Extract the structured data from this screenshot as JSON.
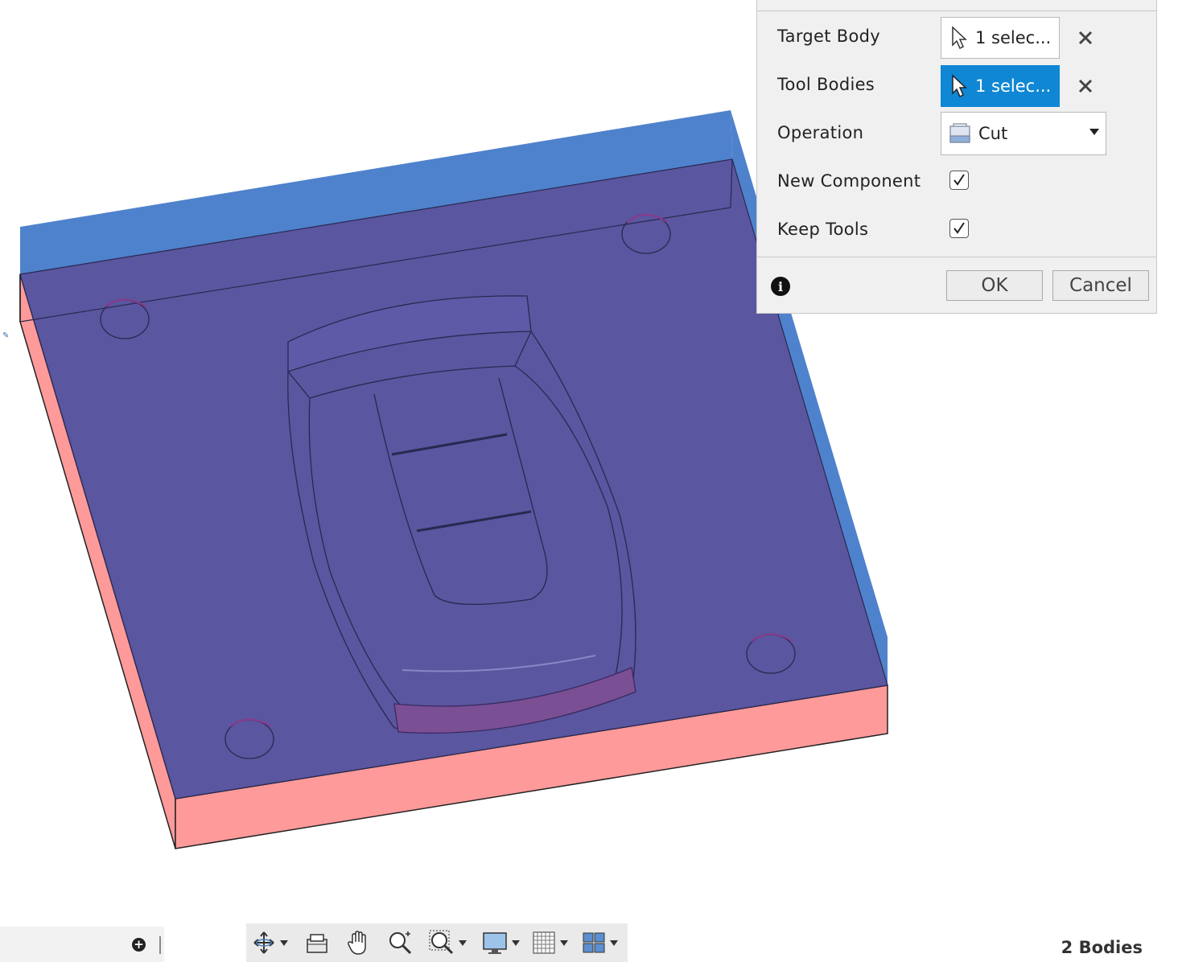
{
  "dialog": {
    "rows": [
      {
        "label": "Target Body",
        "value": "1 selec..."
      },
      {
        "label": "Tool Bodies",
        "value": "1 selec..."
      },
      {
        "label": "Operation",
        "value": "Cut"
      },
      {
        "label": "New Component",
        "checked": true
      },
      {
        "label": "Keep Tools",
        "checked": true
      }
    ],
    "ok_label": "OK",
    "cancel_label": "Cancel"
  },
  "status": {
    "bodies": "2 Bodies"
  },
  "toolbar": {
    "icons": [
      "orbit-icon",
      "look-at-icon",
      "pan-icon",
      "zoom-icon",
      "fit-icon",
      "display-settings-icon",
      "grid-icon",
      "viewports-icon"
    ]
  },
  "colors": {
    "target_body": "#ff9a9a",
    "tool_body": "#4f82cc",
    "overlap": "#5a56a0",
    "selection_active": "#0f87d4"
  }
}
